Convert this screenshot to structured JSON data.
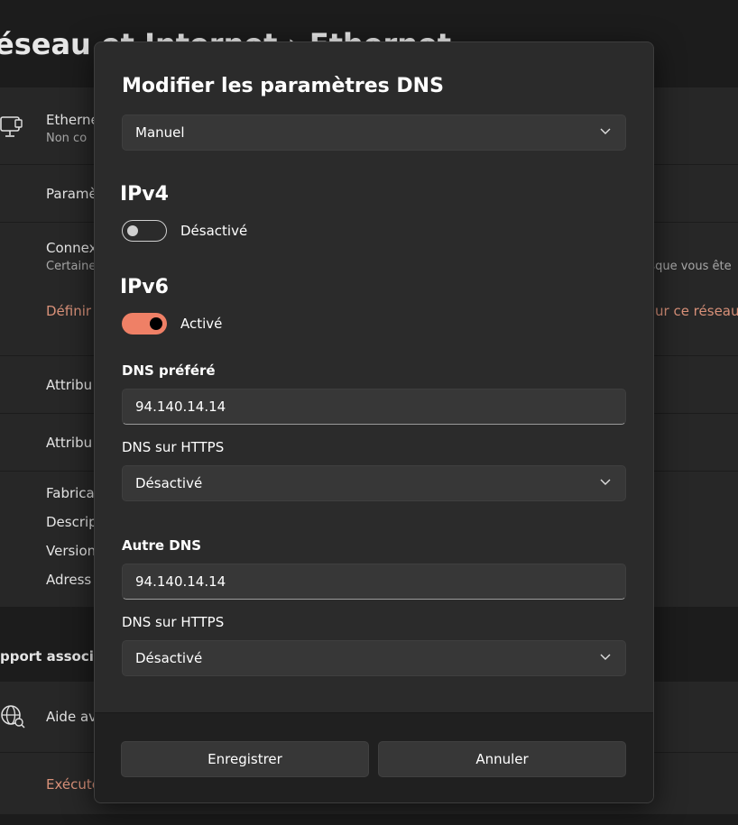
{
  "background": {
    "title": "éseau et Internet  ›  Ethernet",
    "rows": {
      "ethernet_label": "Etherne",
      "ethernet_sub": "Non co",
      "params": "Paramè",
      "connex": "Connex",
      "connex_sub": "Certaine",
      "connex_sub_right": "orsque vous ête",
      "define_link": "Définir",
      "define_link_right": "ur ce réseau",
      "attrib1": "Attribu",
      "attrib2": "Attribu",
      "fabric": "Fabrica",
      "descrip": "Descrip",
      "version": "Version",
      "adresse": "Adress",
      "support_section": "pport associé",
      "aide": "Aide av",
      "executer": "Exécute"
    },
    "icons": [
      "monitor-icon",
      "globe-icon"
    ]
  },
  "dialog": {
    "title": "Modifier les paramètres DNS",
    "mode_select": {
      "value": "Manuel"
    },
    "ipv4": {
      "heading": "IPv4",
      "toggle_state": false,
      "toggle_label": "Désactivé"
    },
    "ipv6": {
      "heading": "IPv6",
      "toggle_state": true,
      "toggle_label": "Activé",
      "preferred_dns_label": "DNS préféré",
      "preferred_dns_value": "94.140.14.14",
      "preferred_https_label": "DNS sur HTTPS",
      "preferred_https_value": "Désactivé",
      "alternate_dns_label": "Autre DNS",
      "alternate_dns_value": "94.140.14.14",
      "alternate_https_label": "DNS sur HTTPS",
      "alternate_https_value": "Désactivé"
    },
    "buttons": {
      "save": "Enregistrer",
      "cancel": "Annuler"
    }
  },
  "colors": {
    "accent": "#ef8066",
    "link": "#d99179",
    "dialog_bg": "#2b2b2b",
    "page_bg": "#1c1c1c"
  }
}
